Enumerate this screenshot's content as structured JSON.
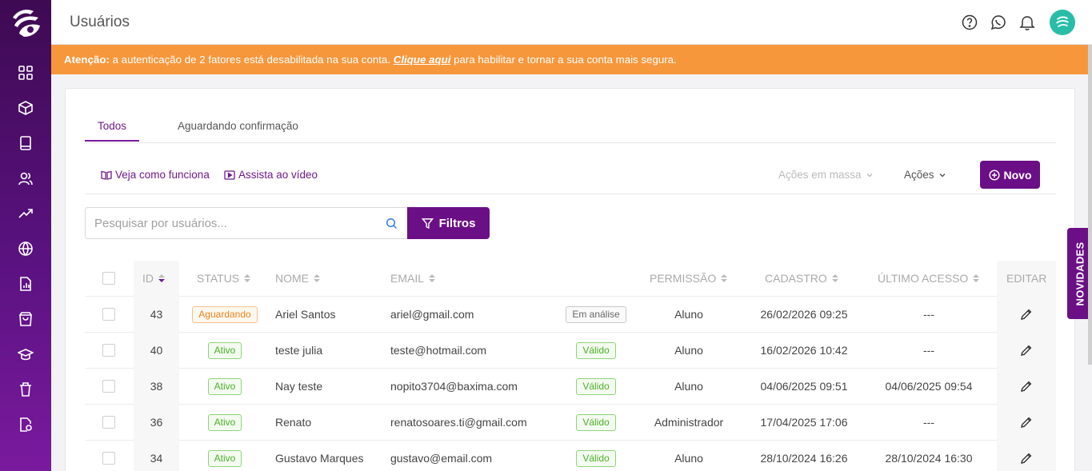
{
  "app": {
    "page_title": "Usuários"
  },
  "sidebar": {
    "items": [
      {
        "icon": "grid-icon"
      },
      {
        "icon": "box-icon"
      },
      {
        "icon": "book-icon"
      },
      {
        "icon": "users-icon"
      },
      {
        "icon": "trending-up-icon"
      },
      {
        "icon": "globe-icon"
      },
      {
        "icon": "report-icon"
      },
      {
        "icon": "shopping-bag-icon"
      },
      {
        "icon": "graduation-cap-icon"
      },
      {
        "icon": "trash-icon"
      },
      {
        "icon": "file-settings-icon"
      }
    ]
  },
  "alert": {
    "label": "Atenção:",
    "text_before": " a autenticação de 2 fatores está desabilitada na sua conta. ",
    "link": "Clique aqui",
    "text_after": " para habilitar e tornar a sua conta mais segura."
  },
  "tabs": [
    {
      "label": "Todos",
      "active": true
    },
    {
      "label": "Aguardando confirmação",
      "active": false
    }
  ],
  "toolbar": {
    "how_it_works": "Veja como funciona",
    "watch_video": "Assista ao vídeo",
    "bulk_actions": "Ações em massa",
    "actions": "Ações",
    "new": "Novo"
  },
  "search": {
    "placeholder": "Pesquisar por usuários...",
    "value": ""
  },
  "filters_button": "Filtros",
  "table": {
    "headers": {
      "id": "ID",
      "status": "STATUS",
      "name": "NOME",
      "email": "EMAIL",
      "permission": "PERMISSÃO",
      "created": "CADASTRO",
      "last_access": "ÚLTIMO ACESSO",
      "edit": "EDITAR"
    },
    "rows": [
      {
        "id": "43",
        "status": "Aguardando",
        "name": "Ariel Santos",
        "email": "ariel@gmail.com",
        "email_status": "Em análise",
        "permission": "Aluno",
        "created": "26/02/2026 09:25",
        "last_access": "---"
      },
      {
        "id": "40",
        "status": "Ativo",
        "name": "teste julia",
        "email": "teste@hotmail.com",
        "email_status": "Válido",
        "permission": "Aluno",
        "created": "16/02/2026 10:42",
        "last_access": "---"
      },
      {
        "id": "38",
        "status": "Ativo",
        "name": "Nay teste",
        "email": "nopito3704@baxima.com",
        "email_status": "Válido",
        "permission": "Aluno",
        "created": "04/06/2025 09:51",
        "last_access": "04/06/2025 09:54"
      },
      {
        "id": "36",
        "status": "Ativo",
        "name": "Renato",
        "email": "renatosoares.ti@gmail.com",
        "email_status": "Válido",
        "permission": "Administrador",
        "created": "17/04/2025 17:06",
        "last_access": "---"
      },
      {
        "id": "34",
        "status": "Ativo",
        "name": "Gustavo Marques",
        "email": "gustavo@email.com",
        "email_status": "Válido",
        "permission": "Aluno",
        "created": "28/10/2024 16:26",
        "last_access": "28/10/2024 16:30"
      }
    ]
  },
  "novidades": "NOVIDADES",
  "colors": {
    "brand": "#6b0f86",
    "alert": "#f7973c",
    "valid": "#4caf2a",
    "pending": "#e8841c"
  }
}
